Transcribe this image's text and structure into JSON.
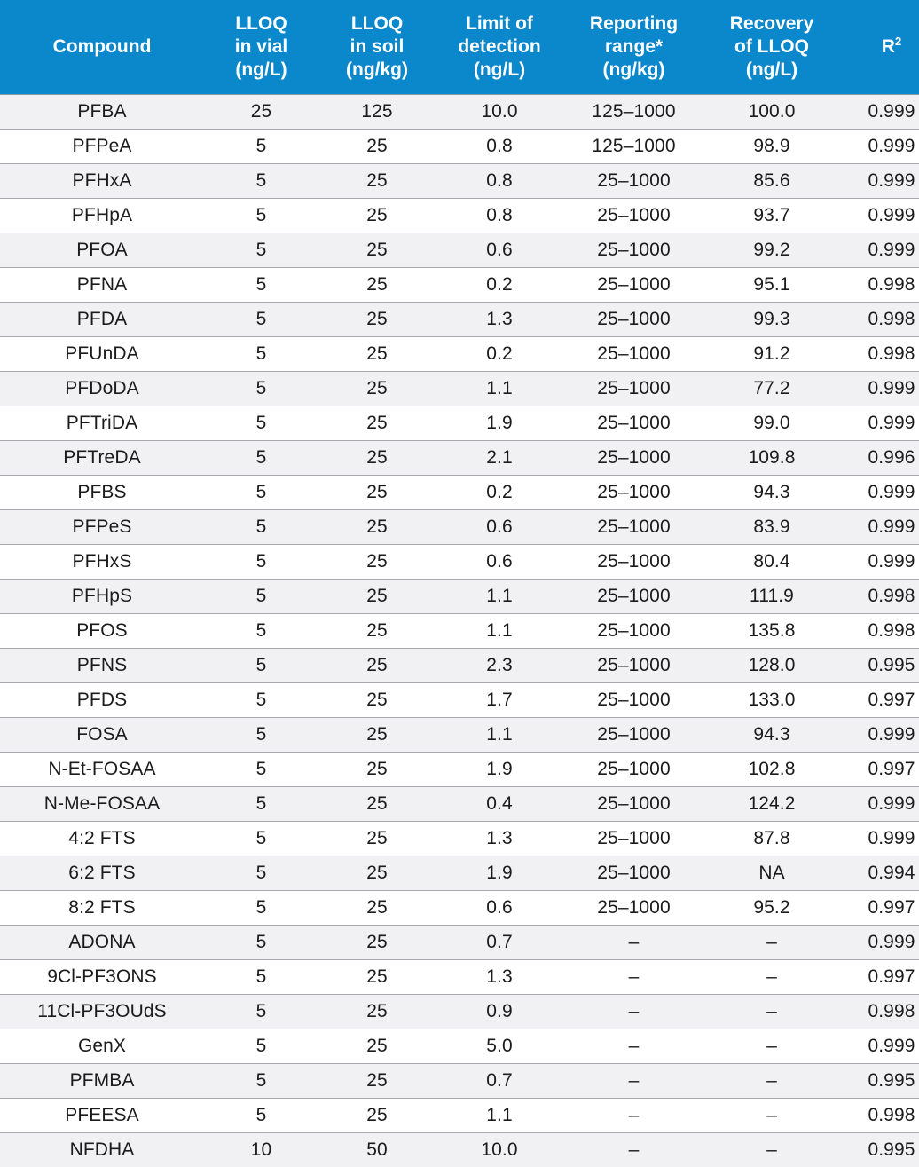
{
  "table": {
    "columns": [
      {
        "id": "compound",
        "label": "Compound",
        "name": "column-header-compound"
      },
      {
        "id": "lloq_vial",
        "label": "LLOQ\nin vial\n(ng/L)",
        "name": "column-header-lloq-in-vial"
      },
      {
        "id": "lloq_soil",
        "label": "LLOQ\nin soil\n(ng/kg)",
        "name": "column-header-lloq-in-soil"
      },
      {
        "id": "lod",
        "label": "Limit of\ndetection\n(ng/L)",
        "name": "column-header-limit-of-detection"
      },
      {
        "id": "range",
        "label": "Reporting\nrange*\n(ng/kg)",
        "name": "column-header-reporting-range"
      },
      {
        "id": "recovery",
        "label": "Recovery\nof LLOQ\n(ng/L)",
        "name": "column-header-recovery-of-lloq"
      },
      {
        "id": "r2",
        "label": "R2",
        "name": "column-header-r-squared"
      }
    ],
    "header_color": "#0b87cb",
    "header_text_color": "#ffffff",
    "row_shaded_color": "#f1f1f4",
    "row_plain_color": "#ffffff",
    "row_border_color": "#a9a9ad",
    "rows": [
      {
        "compound": "PFBA",
        "lloq_vial": "25",
        "lloq_soil": "125",
        "lod": "10.0",
        "range": "125–1000",
        "recovery": "100.0",
        "r2": "0.999"
      },
      {
        "compound": "PFPeA",
        "lloq_vial": "5",
        "lloq_soil": "25",
        "lod": "0.8",
        "range": "125–1000",
        "recovery": "98.9",
        "r2": "0.999"
      },
      {
        "compound": "PFHxA",
        "lloq_vial": "5",
        "lloq_soil": "25",
        "lod": "0.8",
        "range": "25–1000",
        "recovery": "85.6",
        "r2": "0.999"
      },
      {
        "compound": "PFHpA",
        "lloq_vial": "5",
        "lloq_soil": "25",
        "lod": "0.8",
        "range": "25–1000",
        "recovery": "93.7",
        "r2": "0.999"
      },
      {
        "compound": "PFOA",
        "lloq_vial": "5",
        "lloq_soil": "25",
        "lod": "0.6",
        "range": "25–1000",
        "recovery": "99.2",
        "r2": "0.999"
      },
      {
        "compound": "PFNA",
        "lloq_vial": "5",
        "lloq_soil": "25",
        "lod": "0.2",
        "range": "25–1000",
        "recovery": "95.1",
        "r2": "0.998"
      },
      {
        "compound": "PFDA",
        "lloq_vial": "5",
        "lloq_soil": "25",
        "lod": "1.3",
        "range": "25–1000",
        "recovery": "99.3",
        "r2": "0.998"
      },
      {
        "compound": "PFUnDA",
        "lloq_vial": "5",
        "lloq_soil": "25",
        "lod": "0.2",
        "range": "25–1000",
        "recovery": "91.2",
        "r2": "0.998"
      },
      {
        "compound": "PFDoDA",
        "lloq_vial": "5",
        "lloq_soil": "25",
        "lod": "1.1",
        "range": "25–1000",
        "recovery": "77.2",
        "r2": "0.999"
      },
      {
        "compound": "PFTriDA",
        "lloq_vial": "5",
        "lloq_soil": "25",
        "lod": "1.9",
        "range": "25–1000",
        "recovery": "99.0",
        "r2": "0.999"
      },
      {
        "compound": "PFTreDA",
        "lloq_vial": "5",
        "lloq_soil": "25",
        "lod": "2.1",
        "range": "25–1000",
        "recovery": "109.8",
        "r2": "0.996"
      },
      {
        "compound": "PFBS",
        "lloq_vial": "5",
        "lloq_soil": "25",
        "lod": "0.2",
        "range": "25–1000",
        "recovery": "94.3",
        "r2": "0.999"
      },
      {
        "compound": "PFPeS",
        "lloq_vial": "5",
        "lloq_soil": "25",
        "lod": "0.6",
        "range": "25–1000",
        "recovery": "83.9",
        "r2": "0.999"
      },
      {
        "compound": "PFHxS",
        "lloq_vial": "5",
        "lloq_soil": "25",
        "lod": "0.6",
        "range": "25–1000",
        "recovery": "80.4",
        "r2": "0.999"
      },
      {
        "compound": "PFHpS",
        "lloq_vial": "5",
        "lloq_soil": "25",
        "lod": "1.1",
        "range": "25–1000",
        "recovery": "111.9",
        "r2": "0.998"
      },
      {
        "compound": "PFOS",
        "lloq_vial": "5",
        "lloq_soil": "25",
        "lod": "1.1",
        "range": "25–1000",
        "recovery": "135.8",
        "r2": "0.998"
      },
      {
        "compound": "PFNS",
        "lloq_vial": "5",
        "lloq_soil": "25",
        "lod": "2.3",
        "range": "25–1000",
        "recovery": "128.0",
        "r2": "0.995"
      },
      {
        "compound": "PFDS",
        "lloq_vial": "5",
        "lloq_soil": "25",
        "lod": "1.7",
        "range": "25–1000",
        "recovery": "133.0",
        "r2": "0.997"
      },
      {
        "compound": "FOSA",
        "lloq_vial": "5",
        "lloq_soil": "25",
        "lod": "1.1",
        "range": "25–1000",
        "recovery": "94.3",
        "r2": "0.999"
      },
      {
        "compound": "N-Et-FOSAA",
        "lloq_vial": "5",
        "lloq_soil": "25",
        "lod": "1.9",
        "range": "25–1000",
        "recovery": "102.8",
        "r2": "0.997"
      },
      {
        "compound": "N-Me-FOSAA",
        "lloq_vial": "5",
        "lloq_soil": "25",
        "lod": "0.4",
        "range": "25–1000",
        "recovery": "124.2",
        "r2": "0.999"
      },
      {
        "compound": "4:2 FTS",
        "lloq_vial": "5",
        "lloq_soil": "25",
        "lod": "1.3",
        "range": "25–1000",
        "recovery": "87.8",
        "r2": "0.999"
      },
      {
        "compound": "6:2 FTS",
        "lloq_vial": "5",
        "lloq_soil": "25",
        "lod": "1.9",
        "range": "25–1000",
        "recovery": "NA",
        "r2": "0.994"
      },
      {
        "compound": "8:2 FTS",
        "lloq_vial": "5",
        "lloq_soil": "25",
        "lod": "0.6",
        "range": "25–1000",
        "recovery": "95.2",
        "r2": "0.997"
      },
      {
        "compound": "ADONA",
        "lloq_vial": "5",
        "lloq_soil": "25",
        "lod": "0.7",
        "range": "–",
        "recovery": "–",
        "r2": "0.999"
      },
      {
        "compound": "9Cl-PF3ONS",
        "lloq_vial": "5",
        "lloq_soil": "25",
        "lod": "1.3",
        "range": "–",
        "recovery": "–",
        "r2": "0.997"
      },
      {
        "compound": "11Cl-PF3OUdS",
        "lloq_vial": "5",
        "lloq_soil": "25",
        "lod": "0.9",
        "range": "–",
        "recovery": "–",
        "r2": "0.998"
      },
      {
        "compound": "GenX",
        "lloq_vial": "5",
        "lloq_soil": "25",
        "lod": "5.0",
        "range": "–",
        "recovery": "–",
        "r2": "0.999"
      },
      {
        "compound": "PFMBA",
        "lloq_vial": "5",
        "lloq_soil": "25",
        "lod": "0.7",
        "range": "–",
        "recovery": "–",
        "r2": "0.995"
      },
      {
        "compound": "PFEESA",
        "lloq_vial": "5",
        "lloq_soil": "25",
        "lod": "1.1",
        "range": "–",
        "recovery": "–",
        "r2": "0.998"
      },
      {
        "compound": "NFDHA",
        "lloq_vial": "10",
        "lloq_soil": "50",
        "lod": "10.0",
        "range": "–",
        "recovery": "–",
        "r2": "0.995"
      }
    ]
  }
}
